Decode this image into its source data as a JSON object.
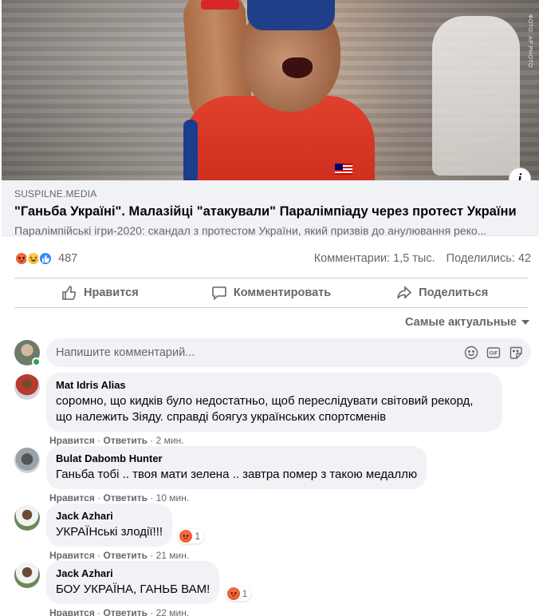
{
  "preview": {
    "credit": "ФОТО: AP PHOTO",
    "info_icon": "i"
  },
  "link": {
    "domain": "SUSPILNE.MEDIA",
    "title": "\"Ганьба Україні\". Малазійці \"атакували\" Паралімпіаду через протест України",
    "description": "Паралімпійські ігри-2020: скандал з протестом України, який призвів до анулювання реко..."
  },
  "reactions": {
    "icons": [
      "angry-icon",
      "haha-icon",
      "like-icon"
    ],
    "count": "487",
    "comments": "Комментарии: 1,5 тыс.",
    "shares": "Поделились: 42"
  },
  "actions": {
    "like": "Нравится",
    "comment": "Комментировать",
    "share": "Поделиться"
  },
  "sort": {
    "label": "Самые актуальные"
  },
  "composer": {
    "placeholder": "Напишите комментарий..."
  },
  "comments": [
    {
      "author": "Mat Idris Alias",
      "text": "соромно, що кидків було недостатньо, щоб переслідувати світовий рекорд, що належить Зіяду. справді боягуз українських спортсменів",
      "like": "Нравится",
      "reply": "Ответить",
      "time": "2 мин.",
      "reaction_count": ""
    },
    {
      "author": "Bulat Dabomb Hunter",
      "text": "Ганьба тобі .. твоя мати зелена .. завтра помер з такою медаллю",
      "like": "Нравится",
      "reply": "Ответить",
      "time": "10 мин.",
      "reaction_count": ""
    },
    {
      "author": "Jack Azhari",
      "text": "УКРАЇНські злодії!!!",
      "like": "Нравится",
      "reply": "Ответить",
      "time": "21 мин.",
      "reaction_count": "1"
    },
    {
      "author": "Jack Azhari",
      "text": "БОУ УКРАЇНА, ГАНЬБ ВАМ!",
      "like": "Нравится",
      "reply": "Ответить",
      "time": "22 мин.",
      "reaction_count": "1"
    }
  ],
  "colors": {
    "secondary_text": "#65676b",
    "bubble_bg": "#f0f2f5",
    "like_blue": "#1877f2",
    "angry_orange": "#e9541f",
    "online_green": "#31a24c"
  }
}
